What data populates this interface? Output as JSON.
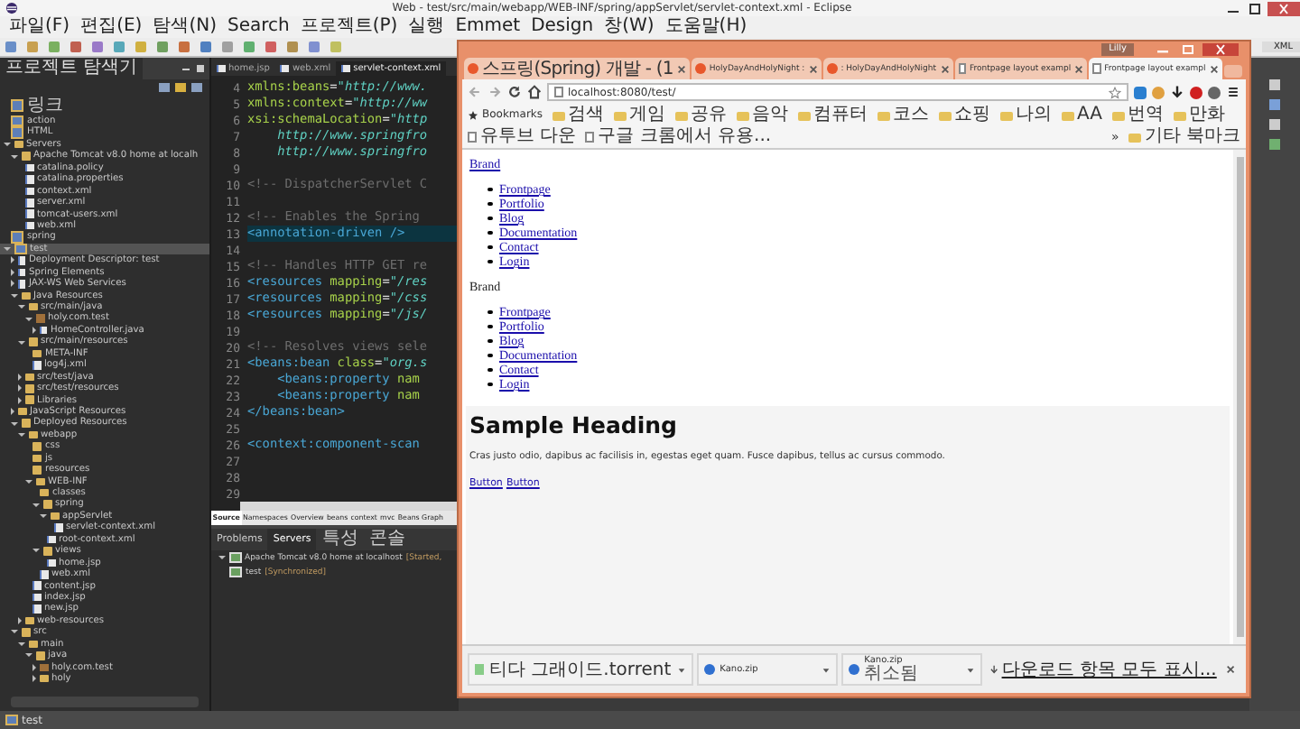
{
  "eclipse": {
    "title": "Web - test/src/main/webapp/WEB-INF/spring/appServlet/servlet-context.xml - Eclipse",
    "menu": [
      "파일(F)",
      "편집(E)",
      "탐색(N)",
      "Search",
      "프로젝트(P)",
      "실행",
      "Emmet",
      "Design",
      "창(W)",
      "도움말(H)"
    ],
    "perspective": "XML"
  },
  "explorer": {
    "title": "프로젝트 탐색기",
    "items": [
      {
        "label": "링크",
        "kind": "project",
        "selected": false
      },
      {
        "label": "action",
        "kind": "project",
        "selected": false
      },
      {
        "label": "HTML",
        "kind": "project",
        "selected": false
      },
      {
        "label": "Servers",
        "kind": "folder",
        "selected": false,
        "expanded": true,
        "children": [
          {
            "label": "Apache Tomcat v8.0 home at localh",
            "kind": "folder",
            "selected": false,
            "expanded": true,
            "children": [
              {
                "label": "catalina.policy",
                "kind": "doc",
                "selected": false
              },
              {
                "label": "catalina.properties",
                "kind": "doc",
                "selected": false
              },
              {
                "label": "context.xml",
                "kind": "doc",
                "selected": false
              },
              {
                "label": "server.xml",
                "kind": "doc",
                "selected": false
              },
              {
                "label": "tomcat-users.xml",
                "kind": "doc",
                "selected": false
              },
              {
                "label": "web.xml",
                "kind": "doc",
                "selected": false
              }
            ]
          }
        ]
      },
      {
        "label": "spring",
        "kind": "project",
        "selected": false
      },
      {
        "label": "test",
        "kind": "project",
        "selected": true,
        "expanded": true,
        "children": [
          {
            "label": "Deployment Descriptor: test",
            "kind": "doc",
            "selected": false,
            "expanded": false
          },
          {
            "label": "Spring Elements",
            "kind": "doc",
            "selected": false,
            "expanded": false
          },
          {
            "label": "JAX-WS Web Services",
            "kind": "doc",
            "selected": false,
            "expanded": false
          },
          {
            "label": "Java Resources",
            "kind": "folder",
            "selected": false,
            "expanded": true,
            "children": [
              {
                "label": "src/main/java",
                "kind": "folder",
                "selected": false,
                "expanded": true,
                "children": [
                  {
                    "label": "holy.com.test",
                    "kind": "package",
                    "selected": false,
                    "expanded": true,
                    "children": [
                      {
                        "label": "HomeController.java",
                        "kind": "doc",
                        "selected": false,
                        "expanded": false
                      }
                    ]
                  }
                ]
              },
              {
                "label": "src/main/resources",
                "kind": "folder",
                "selected": false,
                "expanded": true,
                "children": [
                  {
                    "label": "META-INF",
                    "kind": "folder",
                    "selected": false
                  },
                  {
                    "label": "log4j.xml",
                    "kind": "doc",
                    "selected": false
                  }
                ]
              },
              {
                "label": "src/test/java",
                "kind": "folder",
                "selected": false,
                "expanded": false
              },
              {
                "label": "src/test/resources",
                "kind": "folder",
                "selected": false,
                "expanded": false
              },
              {
                "label": "Libraries",
                "kind": "folder",
                "selected": false,
                "expanded": false
              }
            ]
          },
          {
            "label": "JavaScript Resources",
            "kind": "folder",
            "selected": false,
            "expanded": false
          },
          {
            "label": "Deployed Resources",
            "kind": "folder",
            "selected": false,
            "expanded": true,
            "children": [
              {
                "label": "webapp",
                "kind": "folder",
                "selected": false,
                "expanded": true,
                "children": [
                  {
                    "label": "css",
                    "kind": "folder",
                    "selected": false
                  },
                  {
                    "label": "js",
                    "kind": "folder",
                    "selected": false
                  },
                  {
                    "label": "resources",
                    "kind": "folder",
                    "selected": false
                  },
                  {
                    "label": "WEB-INF",
                    "kind": "folder",
                    "selected": false,
                    "expanded": true,
                    "children": [
                      {
                        "label": "classes",
                        "kind": "folder",
                        "selected": false
                      },
                      {
                        "label": "spring",
                        "kind": "folder",
                        "selected": false,
                        "expanded": true,
                        "children": [
                          {
                            "label": "appServlet",
                            "kind": "folder",
                            "selected": false,
                            "expanded": true,
                            "children": [
                              {
                                "label": "servlet-context.xml",
                                "kind": "doc",
                                "selected": false
                              }
                            ]
                          },
                          {
                            "label": "root-context.xml",
                            "kind": "doc",
                            "selected": false
                          }
                        ]
                      },
                      {
                        "label": "views",
                        "kind": "folder",
                        "selected": false,
                        "expanded": true,
                        "children": [
                          {
                            "label": "home.jsp",
                            "kind": "doc",
                            "selected": false
                          }
                        ]
                      },
                      {
                        "label": "web.xml",
                        "kind": "doc",
                        "selected": false
                      }
                    ]
                  },
                  {
                    "label": "content.jsp",
                    "kind": "doc",
                    "selected": false
                  },
                  {
                    "label": "index.jsp",
                    "kind": "doc",
                    "selected": false
                  },
                  {
                    "label": "new.jsp",
                    "kind": "doc",
                    "selected": false
                  }
                ]
              },
              {
                "label": "web-resources",
                "kind": "folder",
                "selected": false,
                "expanded": false
              }
            ]
          },
          {
            "label": "src",
            "kind": "folder",
            "selected": false,
            "expanded": true,
            "children": [
              {
                "label": "main",
                "kind": "folder",
                "selected": false,
                "expanded": true,
                "children": [
                  {
                    "label": "java",
                    "kind": "folder",
                    "selected": false,
                    "expanded": true,
                    "children": [
                      {
                        "label": "holy.com.test",
                        "kind": "package",
                        "selected": false,
                        "expanded": false
                      },
                      {
                        "label": "holy",
                        "kind": "folder",
                        "selected": false,
                        "expanded": false
                      }
                    ]
                  }
                ]
              }
            ]
          }
        ]
      }
    ]
  },
  "editor": {
    "tabs": [
      {
        "label": "home.jsp",
        "selected": false
      },
      {
        "label": "web.xml",
        "selected": false
      },
      {
        "label": "servlet-context.xml",
        "selected": true
      }
    ],
    "lines": [
      {
        "number": "4",
        "current": false,
        "segments": [
          {
            "kind": "attr",
            "text": "xmlns:beans"
          },
          {
            "kind": "plain",
            "text": "="
          },
          {
            "kind": "value",
            "text": "\"http://www."
          }
        ]
      },
      {
        "number": "5",
        "current": false,
        "segments": [
          {
            "kind": "attr",
            "text": "xmlns:context"
          },
          {
            "kind": "plain",
            "text": "="
          },
          {
            "kind": "value",
            "text": "\"http://ww"
          }
        ]
      },
      {
        "number": "6",
        "current": false,
        "segments": [
          {
            "kind": "attr",
            "text": "xsi:schemaLocation"
          },
          {
            "kind": "plain",
            "text": "="
          },
          {
            "kind": "value",
            "text": "\"http"
          }
        ]
      },
      {
        "number": "7",
        "current": false,
        "segments": [
          {
            "kind": "value",
            "text": "    http://www.springfro"
          }
        ]
      },
      {
        "number": "8",
        "current": false,
        "segments": [
          {
            "kind": "value",
            "text": "    http://www.springfro"
          }
        ]
      },
      {
        "number": "9",
        "current": false
      },
      {
        "number": "10",
        "current": false,
        "segments": [
          {
            "kind": "comment",
            "text": "<!-- DispatcherServlet C"
          }
        ]
      },
      {
        "number": "11",
        "current": false
      },
      {
        "number": "12",
        "current": false,
        "segments": [
          {
            "kind": "comment",
            "text": "<!-- Enables the Spring"
          }
        ]
      },
      {
        "number": "13",
        "current": true,
        "segments": [
          {
            "kind": "tag",
            "text": "<annotation-driven />"
          }
        ]
      },
      {
        "number": "14",
        "current": false
      },
      {
        "number": "15",
        "current": false,
        "segments": [
          {
            "kind": "comment",
            "text": "<!-- Handles HTTP GET re"
          }
        ]
      },
      {
        "number": "16",
        "current": false,
        "segments": [
          {
            "kind": "tag",
            "text": "<resources"
          },
          {
            "kind": "attr",
            "text": " mapping"
          },
          {
            "kind": "plain",
            "text": "="
          },
          {
            "kind": "value",
            "text": "\"/res"
          }
        ]
      },
      {
        "number": "17",
        "current": false,
        "segments": [
          {
            "kind": "tag",
            "text": "<resources"
          },
          {
            "kind": "attr",
            "text": " mapping"
          },
          {
            "kind": "plain",
            "text": "="
          },
          {
            "kind": "value",
            "text": "\"/css"
          }
        ]
      },
      {
        "number": "18",
        "current": false,
        "segments": [
          {
            "kind": "tag",
            "text": "<resources"
          },
          {
            "kind": "attr",
            "text": " mapping"
          },
          {
            "kind": "plain",
            "text": "="
          },
          {
            "kind": "value",
            "text": "\"/js/"
          }
        ]
      },
      {
        "number": "19",
        "current": false
      },
      {
        "number": "20",
        "current": false,
        "segments": [
          {
            "kind": "comment",
            "text": "<!-- Resolves views sele"
          }
        ]
      },
      {
        "number": "21",
        "current": false,
        "segments": [
          {
            "kind": "tag",
            "text": "<beans:bean"
          },
          {
            "kind": "attr",
            "text": " class"
          },
          {
            "kind": "plain",
            "text": "="
          },
          {
            "kind": "value",
            "text": "\"org.s"
          }
        ]
      },
      {
        "number": "22",
        "current": false,
        "segments": [
          {
            "kind": "tag",
            "text": "    <beans:property"
          },
          {
            "kind": "attr",
            "text": " nam"
          }
        ]
      },
      {
        "number": "23",
        "current": false,
        "segments": [
          {
            "kind": "tag",
            "text": "    <beans:property"
          },
          {
            "kind": "attr",
            "text": " nam"
          }
        ]
      },
      {
        "number": "24",
        "current": false,
        "segments": [
          {
            "kind": "tag",
            "text": "</beans:bean>"
          }
        ]
      },
      {
        "number": "25",
        "current": false
      },
      {
        "number": "26",
        "current": false,
        "segments": [
          {
            "kind": "tag",
            "text": "<context:component-scan"
          }
        ]
      },
      {
        "number": "27",
        "current": false
      },
      {
        "number": "28",
        "current": false
      },
      {
        "number": "29",
        "current": false
      }
    ],
    "bottom_tabs": [
      {
        "label": "Source",
        "selected": true
      },
      {
        "label": "Namespaces",
        "selected": false
      },
      {
        "label": "Overview",
        "selected": false
      },
      {
        "label": "beans",
        "selected": false
      },
      {
        "label": "context",
        "selected": false
      },
      {
        "label": "mvc",
        "selected": false
      },
      {
        "label": "Beans Graph",
        "selected": false
      }
    ]
  },
  "servers_view": {
    "tabs": [
      {
        "label": "Problems",
        "selected": false
      },
      {
        "label": "Servers",
        "selected": true
      },
      {
        "label": "특성",
        "selected": false
      },
      {
        "label": "콘솔",
        "selected": false
      }
    ],
    "items": [
      {
        "label": "Apache Tomcat v8.0 home at localhost",
        "status": "[Started,",
        "expanded": true,
        "children": [
          {
            "label": "test",
            "status": "[Synchronized]"
          }
        ]
      }
    ]
  },
  "status_bar": {
    "text": "test"
  },
  "browser": {
    "profile": "Lilly",
    "tabs": [
      {
        "label": "스프링(Spring) 개발 - (1",
        "kind": "site",
        "selected": false
      },
      {
        "label": "HolyDayAndHolyNight :",
        "kind": "site",
        "selected": false
      },
      {
        "label": ": HolyDayAndHolyNight",
        "kind": "site",
        "selected": false
      },
      {
        "label": "Frontpage layout exampl",
        "kind": "page",
        "selected": false
      },
      {
        "label": "Frontpage layout exampl",
        "kind": "page",
        "selected": true
      }
    ],
    "url": "localhost:8080/test/",
    "bookmarks_label": "Bookmarks",
    "bookmarks": [
      {
        "label": "검색",
        "kind": "folder"
      },
      {
        "label": "게임",
        "kind": "folder"
      },
      {
        "label": "공유",
        "kind": "folder"
      },
      {
        "label": "음악",
        "kind": "folder"
      },
      {
        "label": "컴퓨터",
        "kind": "folder"
      },
      {
        "label": "코스",
        "kind": "folder"
      },
      {
        "label": "쇼핑",
        "kind": "folder"
      },
      {
        "label": "나의",
        "kind": "folder"
      },
      {
        "label": "AA",
        "kind": "folder"
      },
      {
        "label": "번역",
        "kind": "folder"
      },
      {
        "label": "만화",
        "kind": "folder"
      },
      {
        "label": "유투브 다운",
        "kind": "page"
      },
      {
        "label": "구글 크롬에서 유용...",
        "kind": "page"
      }
    ],
    "more": "»",
    "other_bookmarks": "기타 북마크",
    "page": {
      "brand_link": "Brand",
      "nav": [
        "Frontpage",
        "Portfolio",
        "Blog",
        "Documentation",
        "Contact",
        "Login"
      ],
      "brand_text": "Brand",
      "nav_2": [
        "Frontpage",
        "Portfolio",
        "Blog",
        "Documentation",
        "Contact",
        "Login"
      ],
      "heading": "Sample Heading",
      "paragraph": "Cras justo odio, dapibus ac facilisis in, egestas eget quam. Fusce dapibus, tellus ac cursus commodo.",
      "buttons": [
        "Button",
        "Button"
      ]
    },
    "downloads": [
      {
        "name": "티다 그래이드.torrent",
        "kind": "torrent"
      },
      {
        "name": "Kano.zip",
        "kind": "zip"
      },
      {
        "name": "Kano.zip",
        "status": "취소됨",
        "kind": "zip"
      }
    ],
    "show_all": "다운로드 항목 모두 표시..."
  }
}
